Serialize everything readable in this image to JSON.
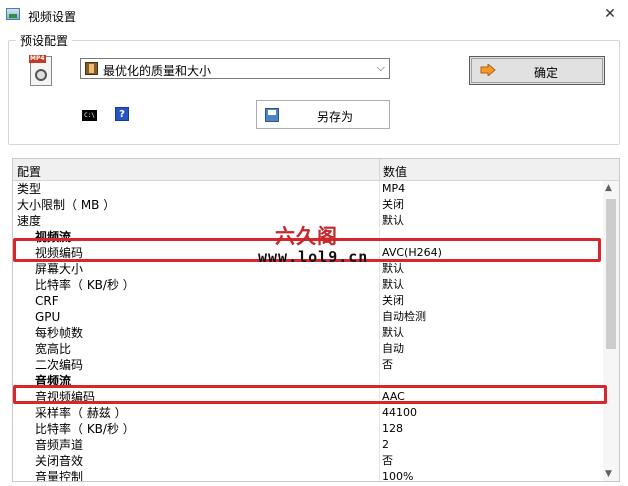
{
  "window": {
    "title": "视频设置"
  },
  "preset": {
    "group_label": "预设配置",
    "mp4_badge": "MP4",
    "selected": "最优化的质量和大小",
    "confirm_label": "确定",
    "saveas_label": "另存为",
    "cmd_glyph": "C:\\",
    "help_glyph": "?"
  },
  "grid": {
    "header_name": "配置",
    "header_value": "数值",
    "rows": [
      {
        "name": "类型",
        "value": "MP4"
      },
      {
        "name": "大小限制（ MB ）",
        "value": "关闭"
      },
      {
        "name": "速度",
        "value": "默认"
      },
      {
        "name": "视频流",
        "value": ""
      },
      {
        "name": "视频编码",
        "value": "AVC(H264)"
      },
      {
        "name": "屏幕大小",
        "value": "默认"
      },
      {
        "name": "比特率（ KB/秒 ）",
        "value": "默认"
      },
      {
        "name": "CRF",
        "value": "关闭"
      },
      {
        "name": "GPU",
        "value": "自动检测"
      },
      {
        "name": "每秒帧数",
        "value": "默认"
      },
      {
        "name": "宽高比",
        "value": "自动"
      },
      {
        "name": "二次编码",
        "value": "否"
      },
      {
        "name": "音频流",
        "value": ""
      },
      {
        "name": "音视频编码",
        "value": "AAC"
      },
      {
        "name": "采样率（ 赫兹 ）",
        "value": "44100"
      },
      {
        "name": "比特率（ KB/秒 ）",
        "value": "128"
      },
      {
        "name": "音频声道",
        "value": "2"
      },
      {
        "name": "关闭音效",
        "value": "否"
      },
      {
        "name": "音量控制",
        "value": "100%"
      }
    ]
  },
  "watermark": {
    "text": "六久阁",
    "url": "www.lol9.cn"
  },
  "colors": {
    "highlight": "#d9262c",
    "watermark": "#c5282a"
  }
}
